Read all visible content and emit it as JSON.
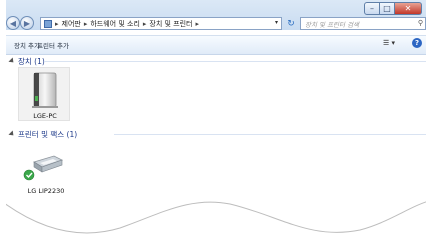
{
  "caption_buttons": {
    "minimize": "–",
    "maximize": "□",
    "close": "✕"
  },
  "nav": {
    "back": "◀",
    "forward": "▶"
  },
  "breadcrumb": [
    "제어판",
    "하드웨어 및 소리",
    "장치 및 프린터"
  ],
  "breadcrumb_separator": "▸",
  "address_dropdown": "▾",
  "refresh_glyph": "↻",
  "search": {
    "placeholder": "장치 및 프린터 검색",
    "icon": "search-icon"
  },
  "toolbar": {
    "add_device": "장치 추가",
    "add_printer": "프린터 추가",
    "view_glyph": "☰ ▾",
    "help_glyph": "?"
  },
  "groups": [
    {
      "title": "장치 (1)",
      "items": [
        {
          "label": "LGE-PC",
          "icon": "computer-icon"
        }
      ]
    },
    {
      "title": "프린터 및 팩스 (1)",
      "items": [
        {
          "label": "LG LIP2230",
          "icon": "printer-icon",
          "default": true
        }
      ]
    }
  ]
}
